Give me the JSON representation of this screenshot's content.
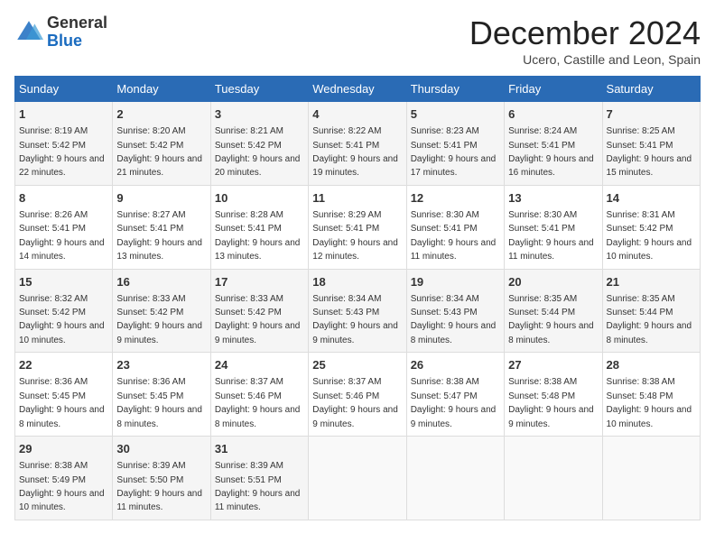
{
  "logo": {
    "general": "General",
    "blue": "Blue"
  },
  "header": {
    "month": "December 2024",
    "location": "Ucero, Castille and Leon, Spain"
  },
  "weekdays": [
    "Sunday",
    "Monday",
    "Tuesday",
    "Wednesday",
    "Thursday",
    "Friday",
    "Saturday"
  ],
  "weeks": [
    [
      {
        "day": 1,
        "sunrise": "8:19 AM",
        "sunset": "5:42 PM",
        "daylight": "9 hours and 22 minutes."
      },
      {
        "day": 2,
        "sunrise": "8:20 AM",
        "sunset": "5:42 PM",
        "daylight": "9 hours and 21 minutes."
      },
      {
        "day": 3,
        "sunrise": "8:21 AM",
        "sunset": "5:42 PM",
        "daylight": "9 hours and 20 minutes."
      },
      {
        "day": 4,
        "sunrise": "8:22 AM",
        "sunset": "5:41 PM",
        "daylight": "9 hours and 19 minutes."
      },
      {
        "day": 5,
        "sunrise": "8:23 AM",
        "sunset": "5:41 PM",
        "daylight": "9 hours and 17 minutes."
      },
      {
        "day": 6,
        "sunrise": "8:24 AM",
        "sunset": "5:41 PM",
        "daylight": "9 hours and 16 minutes."
      },
      {
        "day": 7,
        "sunrise": "8:25 AM",
        "sunset": "5:41 PM",
        "daylight": "9 hours and 15 minutes."
      }
    ],
    [
      {
        "day": 8,
        "sunrise": "8:26 AM",
        "sunset": "5:41 PM",
        "daylight": "9 hours and 14 minutes."
      },
      {
        "day": 9,
        "sunrise": "8:27 AM",
        "sunset": "5:41 PM",
        "daylight": "9 hours and 13 minutes."
      },
      {
        "day": 10,
        "sunrise": "8:28 AM",
        "sunset": "5:41 PM",
        "daylight": "9 hours and 13 minutes."
      },
      {
        "day": 11,
        "sunrise": "8:29 AM",
        "sunset": "5:41 PM",
        "daylight": "9 hours and 12 minutes."
      },
      {
        "day": 12,
        "sunrise": "8:30 AM",
        "sunset": "5:41 PM",
        "daylight": "9 hours and 11 minutes."
      },
      {
        "day": 13,
        "sunrise": "8:30 AM",
        "sunset": "5:41 PM",
        "daylight": "9 hours and 11 minutes."
      },
      {
        "day": 14,
        "sunrise": "8:31 AM",
        "sunset": "5:42 PM",
        "daylight": "9 hours and 10 minutes."
      }
    ],
    [
      {
        "day": 15,
        "sunrise": "8:32 AM",
        "sunset": "5:42 PM",
        "daylight": "9 hours and 10 minutes."
      },
      {
        "day": 16,
        "sunrise": "8:33 AM",
        "sunset": "5:42 PM",
        "daylight": "9 hours and 9 minutes."
      },
      {
        "day": 17,
        "sunrise": "8:33 AM",
        "sunset": "5:42 PM",
        "daylight": "9 hours and 9 minutes."
      },
      {
        "day": 18,
        "sunrise": "8:34 AM",
        "sunset": "5:43 PM",
        "daylight": "9 hours and 9 minutes."
      },
      {
        "day": 19,
        "sunrise": "8:34 AM",
        "sunset": "5:43 PM",
        "daylight": "9 hours and 8 minutes."
      },
      {
        "day": 20,
        "sunrise": "8:35 AM",
        "sunset": "5:44 PM",
        "daylight": "9 hours and 8 minutes."
      },
      {
        "day": 21,
        "sunrise": "8:35 AM",
        "sunset": "5:44 PM",
        "daylight": "9 hours and 8 minutes."
      }
    ],
    [
      {
        "day": 22,
        "sunrise": "8:36 AM",
        "sunset": "5:45 PM",
        "daylight": "9 hours and 8 minutes."
      },
      {
        "day": 23,
        "sunrise": "8:36 AM",
        "sunset": "5:45 PM",
        "daylight": "9 hours and 8 minutes."
      },
      {
        "day": 24,
        "sunrise": "8:37 AM",
        "sunset": "5:46 PM",
        "daylight": "9 hours and 8 minutes."
      },
      {
        "day": 25,
        "sunrise": "8:37 AM",
        "sunset": "5:46 PM",
        "daylight": "9 hours and 9 minutes."
      },
      {
        "day": 26,
        "sunrise": "8:38 AM",
        "sunset": "5:47 PM",
        "daylight": "9 hours and 9 minutes."
      },
      {
        "day": 27,
        "sunrise": "8:38 AM",
        "sunset": "5:48 PM",
        "daylight": "9 hours and 9 minutes."
      },
      {
        "day": 28,
        "sunrise": "8:38 AM",
        "sunset": "5:48 PM",
        "daylight": "9 hours and 10 minutes."
      }
    ],
    [
      {
        "day": 29,
        "sunrise": "8:38 AM",
        "sunset": "5:49 PM",
        "daylight": "9 hours and 10 minutes."
      },
      {
        "day": 30,
        "sunrise": "8:39 AM",
        "sunset": "5:50 PM",
        "daylight": "9 hours and 11 minutes."
      },
      {
        "day": 31,
        "sunrise": "8:39 AM",
        "sunset": "5:51 PM",
        "daylight": "9 hours and 11 minutes."
      },
      null,
      null,
      null,
      null
    ]
  ],
  "labels": {
    "sunrise": "Sunrise:",
    "sunset": "Sunset:",
    "daylight": "Daylight:"
  }
}
